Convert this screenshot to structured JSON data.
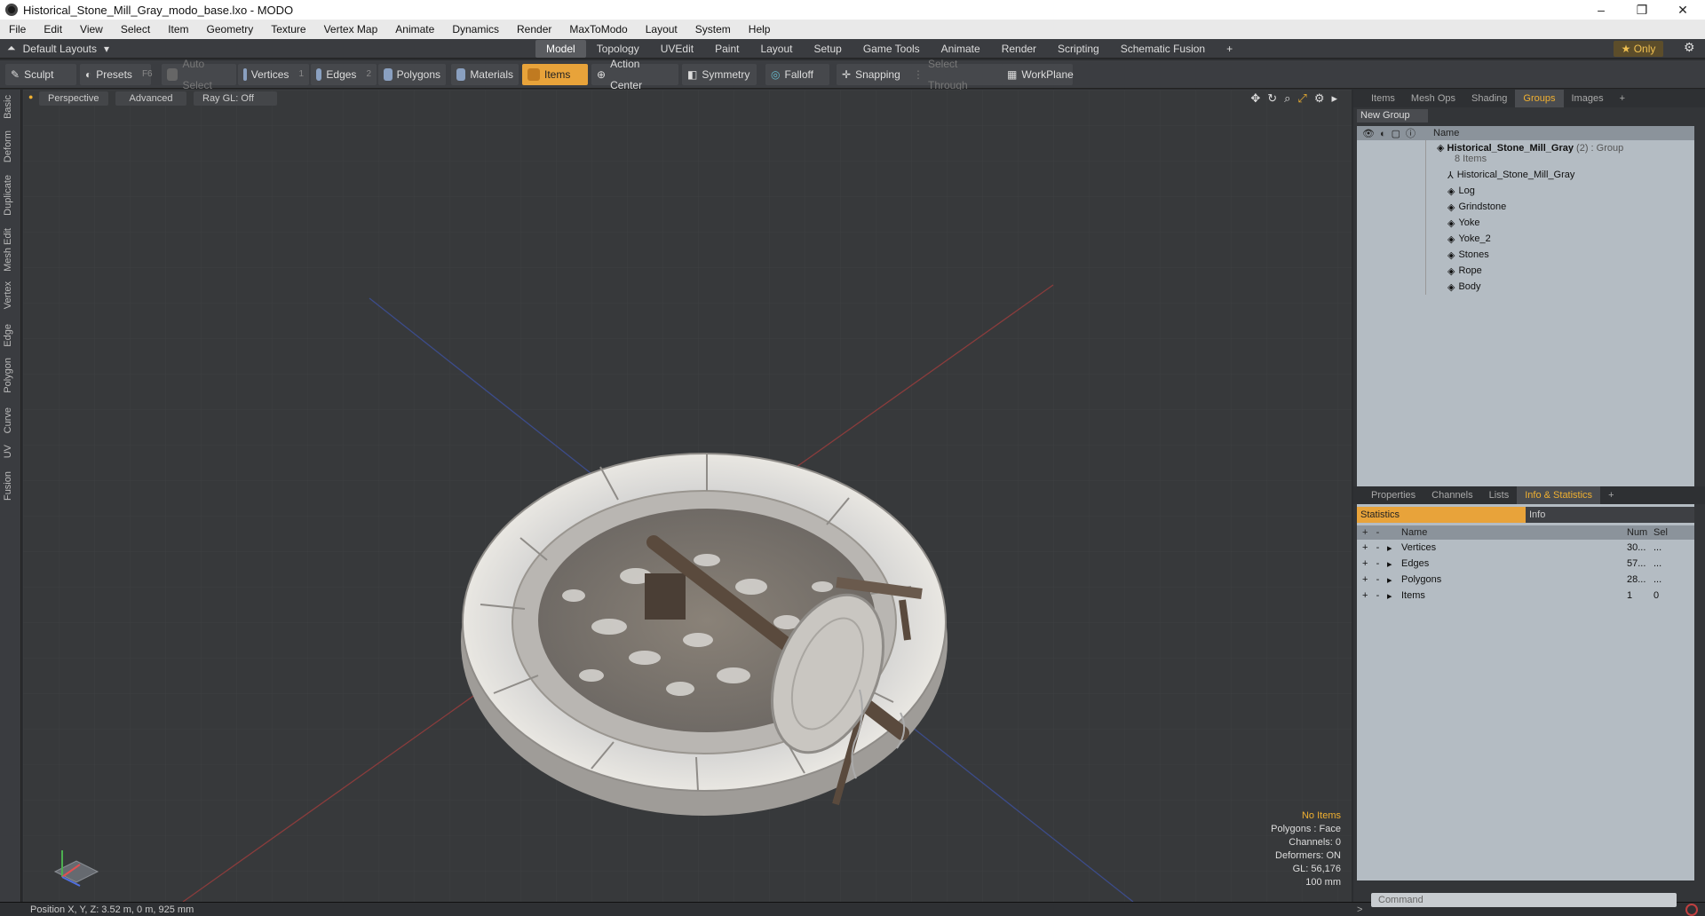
{
  "window": {
    "title": "Historical_Stone_Mill_Gray_modo_base.lxo - MODO"
  },
  "menu": [
    "File",
    "Edit",
    "View",
    "Select",
    "Item",
    "Geometry",
    "Texture",
    "Vertex Map",
    "Animate",
    "Dynamics",
    "Render",
    "MaxToModo",
    "Layout",
    "System",
    "Help"
  ],
  "layoutbar": {
    "layout_label": "Default Layouts",
    "tabs": [
      "Model",
      "Topology",
      "UVEdit",
      "Paint",
      "Layout",
      "Setup",
      "Game Tools",
      "Animate",
      "Render",
      "Scripting",
      "Schematic Fusion"
    ],
    "active_tab": "Model",
    "only_label": "Only"
  },
  "toolbar": {
    "sculpt": "Sculpt",
    "presets": "Presets",
    "presets_key": "F6",
    "auto_select": "Auto Select",
    "vertices": "Vertices",
    "vertices_count": "1",
    "edges": "Edges",
    "edges_count": "2",
    "polygons": "Polygons",
    "materials": "Materials",
    "items": "Items",
    "action_center": "Action Center",
    "symmetry": "Symmetry",
    "falloff": "Falloff",
    "snapping": "Snapping",
    "select_through": "Select Through",
    "workplane": "WorkPlane"
  },
  "left_tabs": [
    "Basic",
    "Deform",
    "Duplicate",
    "Mesh Edit",
    "Vertex",
    "Edge",
    "Polygon",
    "Curve",
    "UV",
    "Fusion"
  ],
  "viewport": {
    "perspective": "Perspective",
    "advanced": "Advanced",
    "raygl": "Ray GL: Off",
    "info": {
      "no_items": "No Items",
      "polygons": "Polygons : Face",
      "channels": "Channels: 0",
      "deformers": "Deformers: ON",
      "gl": "GL: 56,176",
      "scale": "100 mm"
    }
  },
  "groups_panel": {
    "tabs": [
      "Items",
      "Mesh Ops",
      "Shading",
      "Groups",
      "Images"
    ],
    "active_tab": "Groups",
    "new_group": "New Group",
    "name_header": "Name",
    "group_name": "Historical_Stone_Mill_Gray",
    "group_suffix": "(2) : Group",
    "group_count": "8 Items",
    "items": [
      "Historical_Stone_Mill_Gray",
      "Log",
      "Grindstone",
      "Yoke",
      "Yoke_2",
      "Stones",
      "Rope",
      "Body"
    ]
  },
  "stats_panel": {
    "tabs": [
      "Properties",
      "Channels",
      "Lists",
      "Info & Statistics"
    ],
    "active_tab": "Info & Statistics",
    "statistics": "Statistics",
    "info": "Info",
    "headers": {
      "name": "Name",
      "num": "Num",
      "sel": "Sel"
    },
    "rows": [
      {
        "name": "Vertices",
        "num": "30...",
        "sel": "..."
      },
      {
        "name": "Edges",
        "num": "57...",
        "sel": "..."
      },
      {
        "name": "Polygons",
        "num": "28...",
        "sel": "..."
      },
      {
        "name": "Items",
        "num": "1",
        "sel": "0"
      }
    ]
  },
  "status": {
    "position": "Position X, Y, Z:  3.52 m, 0 m, 925 mm"
  },
  "command_placeholder": "Command",
  "colors": {
    "accent": "#e8a33a",
    "viewport_bg": "#37393b"
  }
}
